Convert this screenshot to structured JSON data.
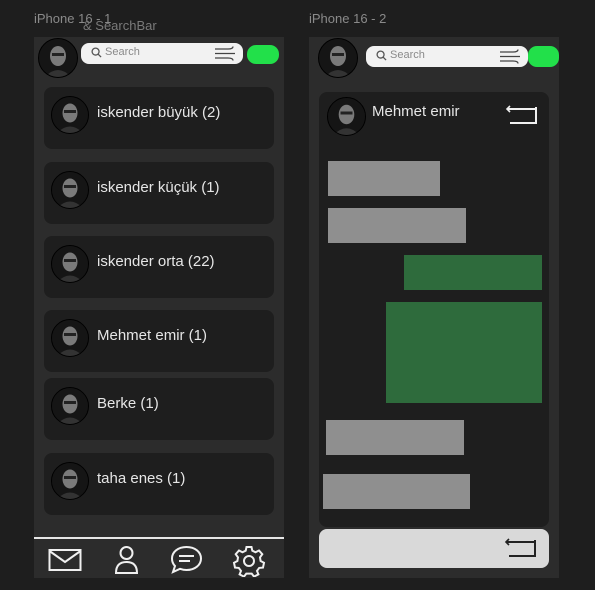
{
  "frames": {
    "left_title": "iPhone 16 - 1",
    "right_title": "iPhone 16 - 2",
    "overlay_label": "& SearchBar"
  },
  "search": {
    "placeholder": "Search"
  },
  "contacts": [
    {
      "label": "iskender büyük (2)"
    },
    {
      "label": "iskender küçük (1)"
    },
    {
      "label": "iskender orta (22)"
    },
    {
      "label": "Mehmet emir (1)"
    },
    {
      "label": "Berke (1)"
    },
    {
      "label": "taha enes (1)"
    }
  ],
  "bottom_nav": {
    "items": [
      {
        "icon": "mail-icon"
      },
      {
        "icon": "user-icon"
      },
      {
        "icon": "chat-bubble-icon"
      },
      {
        "icon": "gear-icon"
      }
    ]
  },
  "chat": {
    "contact_name": "Mehmet emir",
    "back_icon": "return-arrow-icon",
    "messages": [
      {
        "sender": "other"
      },
      {
        "sender": "other"
      },
      {
        "sender": "me"
      },
      {
        "sender": "me"
      },
      {
        "sender": "other"
      },
      {
        "sender": "other"
      }
    ],
    "send_icon": "return-arrow-icon"
  },
  "colors": {
    "toggle": "#22e04a",
    "received_bubble": "#8f8f8f",
    "sent_bubble": "#2e6b3c",
    "card": "#1e1e1e",
    "phone_bg": "#2c2c2c"
  }
}
